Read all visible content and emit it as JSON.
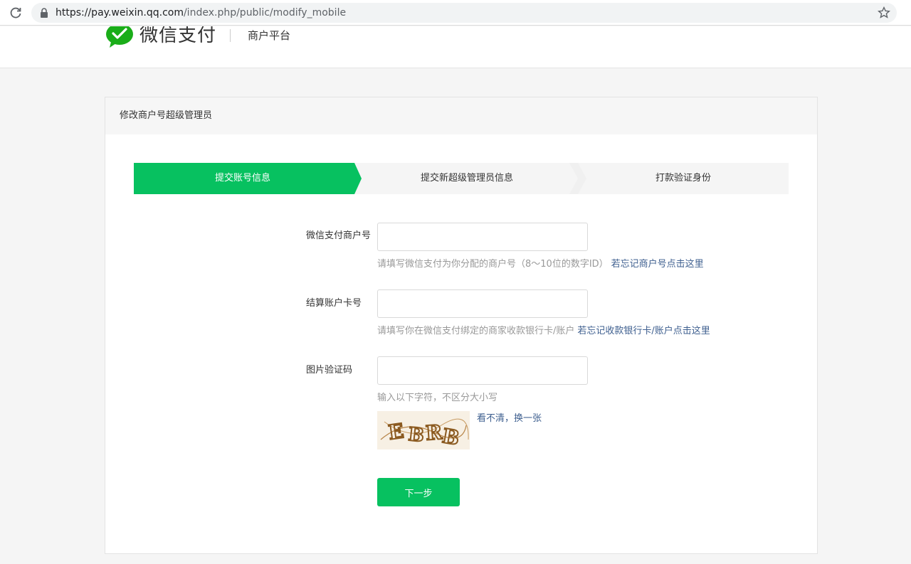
{
  "browser": {
    "url_host": "https://pay.weixin.qq.com",
    "url_path": "/index.php/public/modify_mobile"
  },
  "header": {
    "brand": "微信支付",
    "platform": "商户平台",
    "brand_color": "#1aad19"
  },
  "card": {
    "title": "修改商户号超级管理员"
  },
  "steps": [
    {
      "label": "提交账号信息",
      "active": true
    },
    {
      "label": "提交新超级管理员信息",
      "active": false
    },
    {
      "label": "打款验证身份",
      "active": false
    }
  ],
  "form": {
    "merchant_id": {
      "label": "微信支付商户号",
      "value": "",
      "hint": "请填写微信支付为你分配的商户号（8～10位的数字ID）",
      "link": "若忘记商户号点击这里"
    },
    "bank_account": {
      "label": "结算账户卡号",
      "value": "",
      "hint": "请填写你在微信支付绑定的商家收款银行卡/账户",
      "link": "若忘记收款银行卡/账户点击这里"
    },
    "captcha": {
      "label": "图片验证码",
      "value": "",
      "hint": "输入以下字符，不区分大小写",
      "image_text": "EBRB",
      "refresh_link": "看不清，换一张"
    },
    "next_button": "下一步"
  },
  "colors": {
    "accent": "#07c160",
    "link": "#3e5f8f"
  }
}
